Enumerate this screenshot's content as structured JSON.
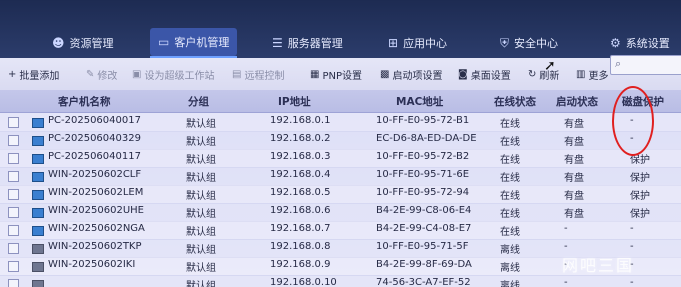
{
  "nav": {
    "items": [
      {
        "label": "资源管理",
        "icon": "face-icon"
      },
      {
        "label": "客户机管理",
        "icon": "monitor-icon"
      },
      {
        "label": "服务器管理",
        "icon": "list-icon"
      },
      {
        "label": "应用中心",
        "icon": "bag-icon"
      },
      {
        "label": "安全中心",
        "icon": "shield-icon"
      },
      {
        "label": "系统设置",
        "icon": "gear-icon"
      }
    ]
  },
  "toolbar": {
    "batch_add": "批量添加",
    "modify": "修改",
    "set_workstation": "设为超级工作站",
    "remote_control": "远程控制",
    "pnp_settings": "PNP设置",
    "boot_settings": "启动项设置",
    "desktop_settings": "桌面设置",
    "refresh": "刷新",
    "more": "更多"
  },
  "table": {
    "columns": [
      "客户机名称",
      "分组",
      "IP地址",
      "MAC地址",
      "在线状态",
      "启动状态",
      "磁盘保护"
    ],
    "rows": [
      {
        "name": "PC-202506040017",
        "group": "默认组",
        "ip": "192.168.0.1",
        "mac": "10-FF-E0-95-72-B1",
        "online": "在线",
        "boot": "有盘",
        "protect": "-"
      },
      {
        "name": "PC-202506040329",
        "group": "默认组",
        "ip": "192.168.0.2",
        "mac": "EC-D6-8A-ED-DA-DE",
        "online": "在线",
        "boot": "有盘",
        "protect": "-"
      },
      {
        "name": "PC-202506040117",
        "group": "默认组",
        "ip": "192.168.0.3",
        "mac": "10-FF-E0-95-72-B2",
        "online": "在线",
        "boot": "有盘",
        "protect": "保护"
      },
      {
        "name": "WIN-20250602CLF",
        "group": "默认组",
        "ip": "192.168.0.4",
        "mac": "10-FF-E0-95-71-6E",
        "online": "在线",
        "boot": "有盘",
        "protect": "保护"
      },
      {
        "name": "WIN-20250602LEM",
        "group": "默认组",
        "ip": "192.168.0.5",
        "mac": "10-FF-E0-95-72-94",
        "online": "在线",
        "boot": "有盘",
        "protect": "保护"
      },
      {
        "name": "WIN-20250602UHE",
        "group": "默认组",
        "ip": "192.168.0.6",
        "mac": "B4-2E-99-C8-06-E4",
        "online": "在线",
        "boot": "有盘",
        "protect": "保护"
      },
      {
        "name": "WIN-20250602NGA",
        "group": "默认组",
        "ip": "192.168.0.7",
        "mac": "B4-2E-99-C4-08-E7",
        "online": "在线",
        "boot": "-",
        "protect": "-"
      },
      {
        "name": "WIN-20250602TKP",
        "group": "默认组",
        "ip": "192.168.0.8",
        "mac": "10-FF-E0-95-71-5F",
        "online": "离线",
        "boot": "-",
        "protect": "-"
      },
      {
        "name": "WIN-20250602IKI",
        "group": "默认组",
        "ip": "192.168.0.9",
        "mac": "B4-2E-99-8F-69-DA",
        "online": "离线",
        "boot": "-",
        "protect": "-"
      },
      {
        "name": "",
        "group": "默认组",
        "ip": "192.168.0.10",
        "mac": "74-56-3C-A7-EF-52",
        "online": "离线",
        "boot": "-",
        "protect": "-"
      }
    ]
  },
  "watermark": "网吧三国"
}
